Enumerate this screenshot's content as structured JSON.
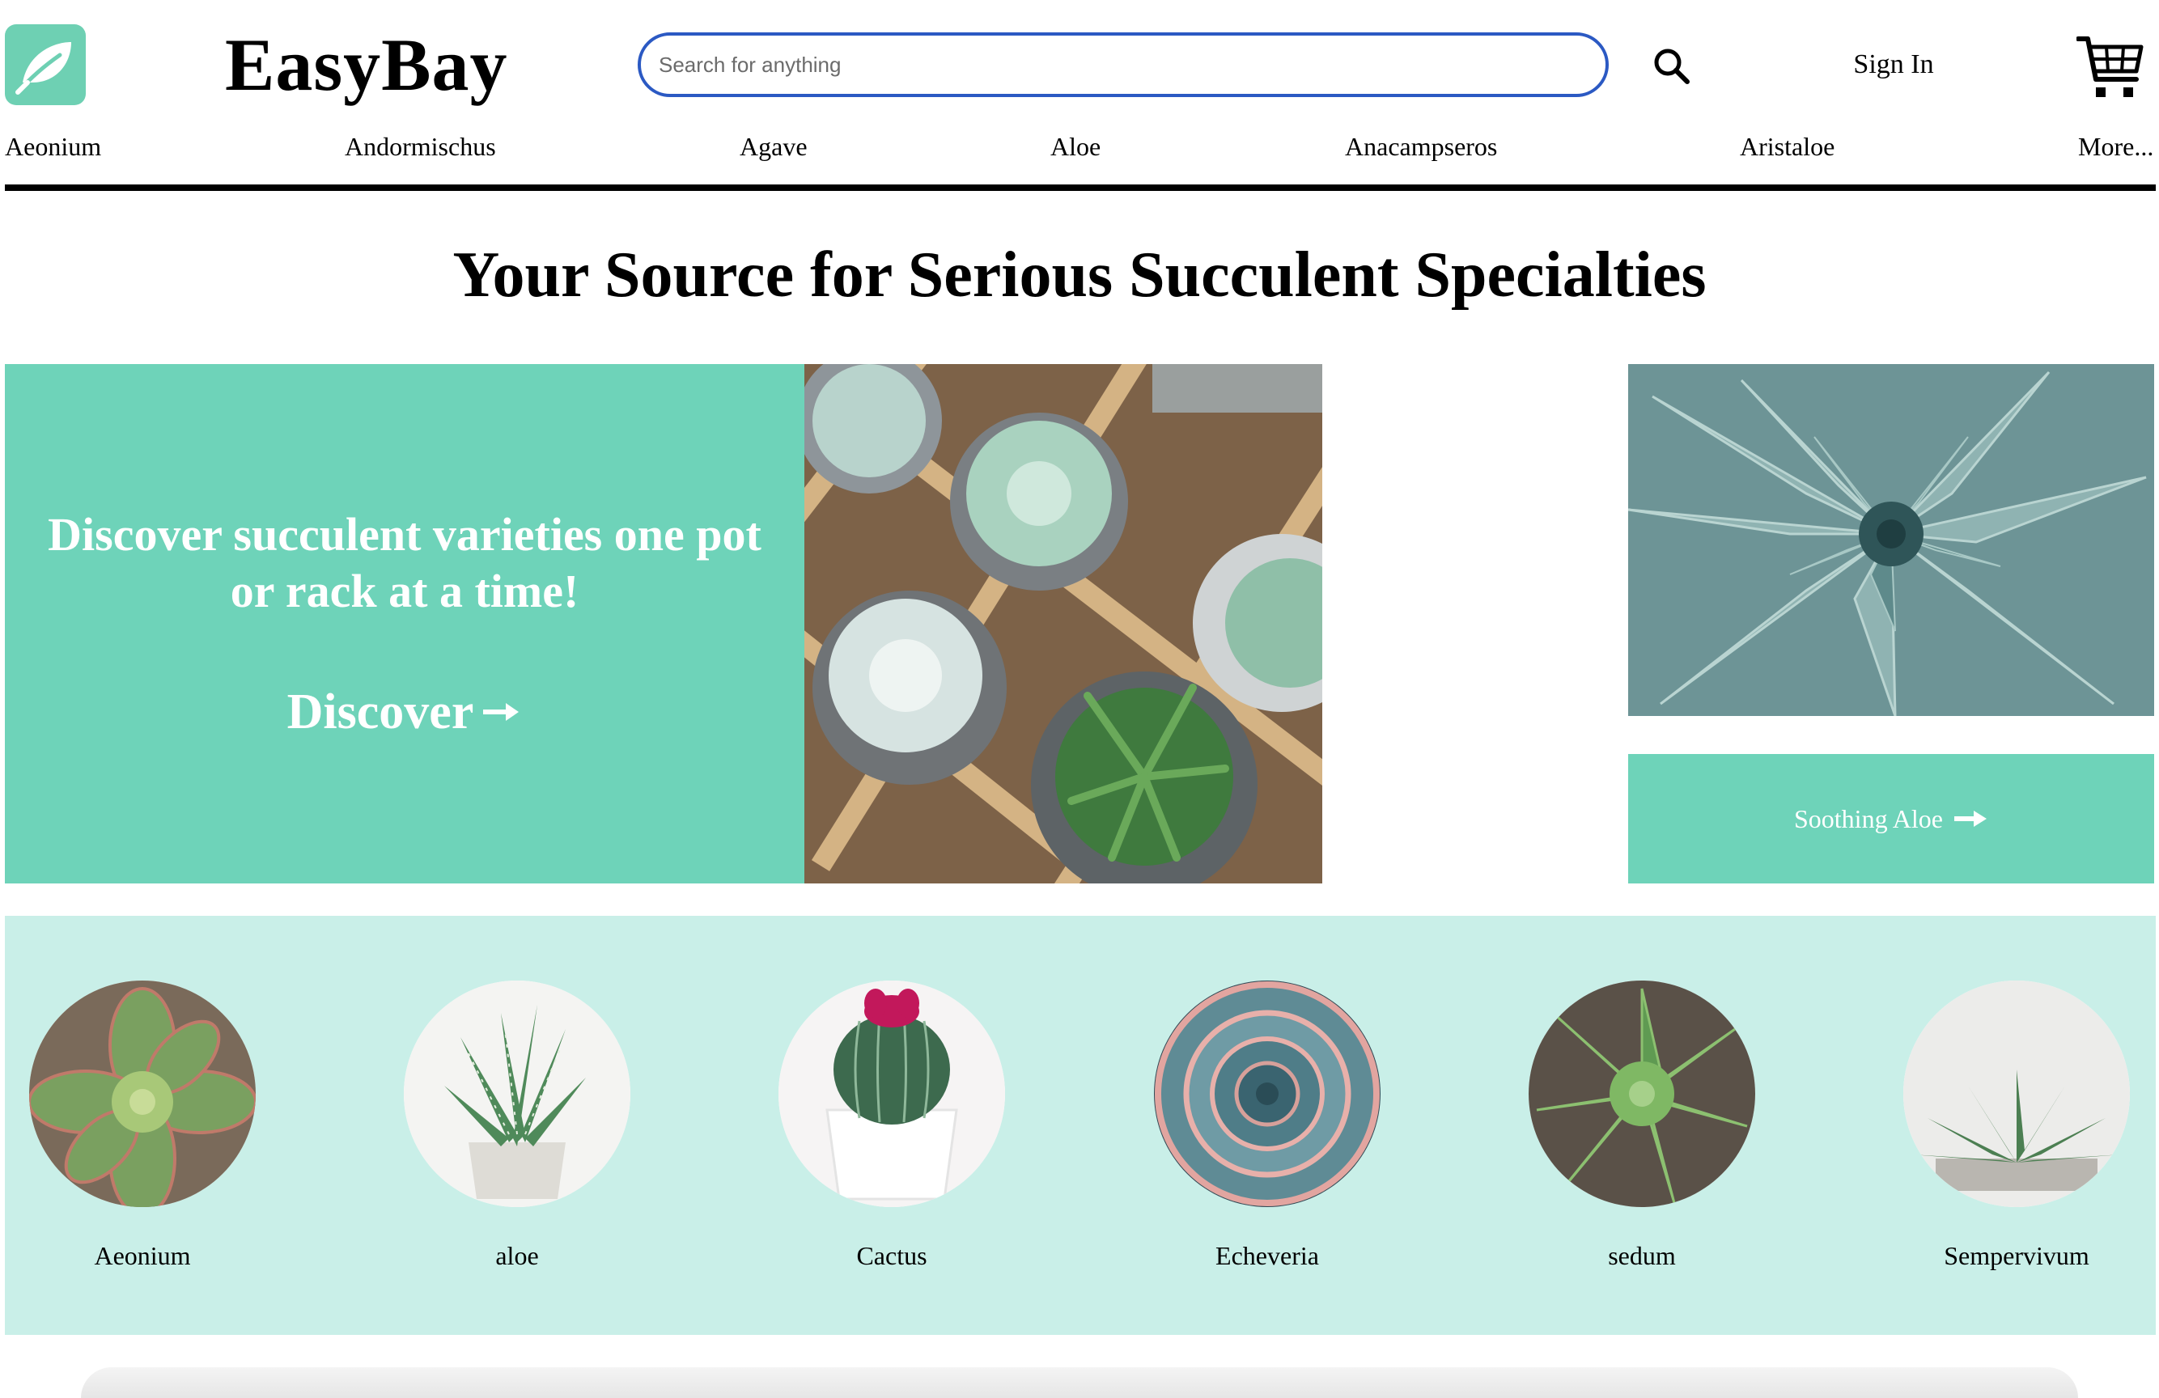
{
  "header": {
    "brand": "EasyBay",
    "search_placeholder": "Search for anything",
    "sign_in": "Sign In"
  },
  "categories": [
    "Aeonium",
    "Andormischus",
    "Agave",
    "Aloe",
    "Anacampseros",
    "Aristaloe",
    "More..."
  ],
  "headline": "Your Source for Serious Succulent Specialties",
  "hero": {
    "tagline": "Discover succulent varieties one pot or rack at a time!",
    "cta": "Discover"
  },
  "promo": {
    "label": "Soothing Aloe"
  },
  "featured": [
    {
      "label": "Aeonium"
    },
    {
      "label": "aloe"
    },
    {
      "label": "Cactus"
    },
    {
      "label": "Echeveria"
    },
    {
      "label": "sedum"
    },
    {
      "label": "Sempervivum"
    }
  ],
  "colors": {
    "accent": "#6ed3b9",
    "light_band": "#c9efe8",
    "search_border": "#2b59c3"
  },
  "icons": [
    "leaf-logo-icon",
    "search-icon",
    "cart-icon",
    "arrow-right-icon"
  ]
}
